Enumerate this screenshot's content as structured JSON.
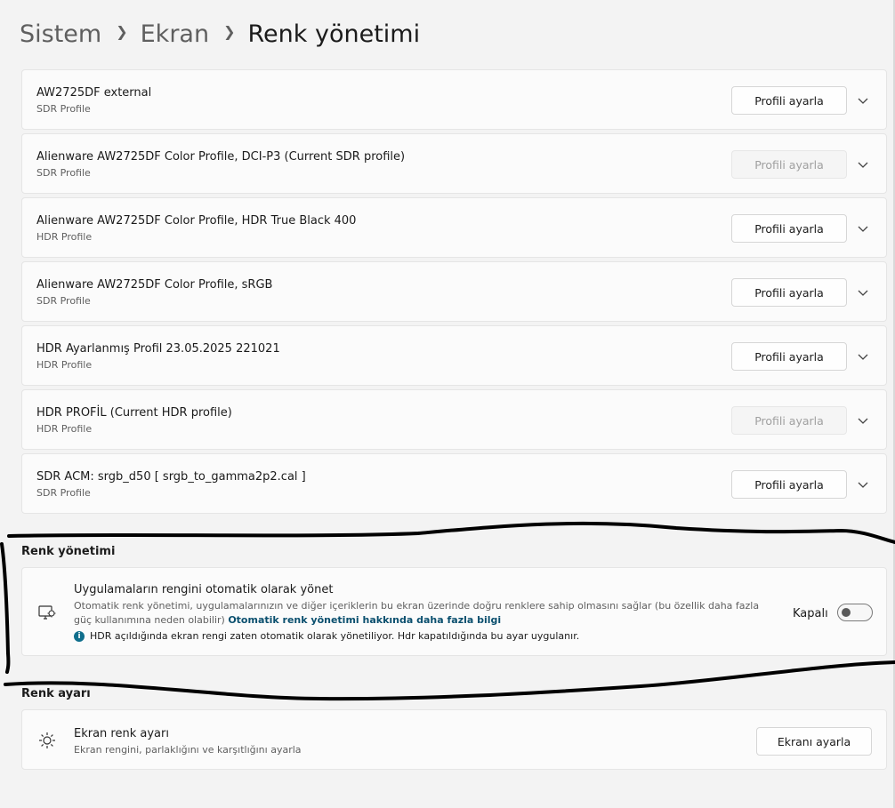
{
  "breadcrumb": [
    "Sistem",
    "Ekran",
    "Renk yönetimi"
  ],
  "profiles": [
    {
      "title": "AW2725DF external",
      "type": "SDR Profile",
      "button": "Profili ayarla",
      "disabled": false
    },
    {
      "title": "Alienware AW2725DF Color Profile, DCI-P3 (Current SDR profile)",
      "type": "SDR Profile",
      "button": "Profili ayarla",
      "disabled": true
    },
    {
      "title": "Alienware AW2725DF Color Profile, HDR True Black 400",
      "type": "HDR Profile",
      "button": "Profili ayarla",
      "disabled": false
    },
    {
      "title": "Alienware AW2725DF Color Profile, sRGB",
      "type": "SDR Profile",
      "button": "Profili ayarla",
      "disabled": false
    },
    {
      "title": "HDR Ayarlanmış Profil 23.05.2025 221021",
      "type": "HDR Profile",
      "button": "Profili ayarla",
      "disabled": false
    },
    {
      "title": "HDR PROFİL  (Current HDR profile)",
      "type": "HDR Profile",
      "button": "Profili ayarla",
      "disabled": true
    },
    {
      "title": "SDR ACM: srgb_d50 [ srgb_to_gamma2p2.cal ]",
      "type": "SDR Profile",
      "button": "Profili ayarla",
      "disabled": false
    }
  ],
  "color_management": {
    "section_title": "Renk yönetimi",
    "title": "Uygulamaların rengini otomatik olarak yönet",
    "description": "Otomatik renk yönetimi, uygulamalarınızın ve diğer içeriklerin bu ekran üzerinde doğru renklere sahip olmasını sağlar (bu özellik daha fazla güç kullanımına neden olabilir)",
    "link": "Otomatik renk yönetimi hakkında daha fazla bilgi",
    "info": "HDR açıldığında ekran rengi zaten otomatik olarak yönetiliyor. Hdr kapatıldığında bu ayar uygulanır.",
    "toggle_label": "Kapalı",
    "toggle_on": false
  },
  "calibration": {
    "section_title": "Renk ayarı",
    "title": "Ekran renk ayarı",
    "subtitle": "Ekran rengini, parlaklığını ve karşıtlığını ayarla",
    "button": "Ekranı ayarla"
  },
  "colors": {
    "background": "#f3f3f3",
    "card": "#fbfbfb",
    "link": "#0a4f6e",
    "info_icon": "#0f6e8c"
  }
}
